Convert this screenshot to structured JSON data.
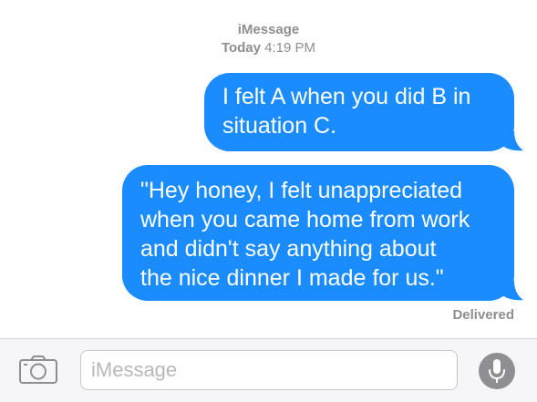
{
  "conversation_header": {
    "service": "iMessage",
    "day": "Today",
    "time": "4:19 PM"
  },
  "messages": [
    {
      "direction": "outgoing",
      "text": "I felt A when you did B in\nsituation C."
    },
    {
      "direction": "outgoing",
      "text": "\"Hey honey, I felt unappreciated\nwhen you came home from work\nand didn't say anything about\nthe nice dinner I made for us.\""
    }
  ],
  "delivery_status": "Delivered",
  "input_bar": {
    "placeholder": "iMessage",
    "value": "",
    "left_icon": "camera-icon",
    "right_icon": "microphone-icon"
  },
  "colors": {
    "bubble": "#1a8cff",
    "meta_text": "#8e8e93",
    "bar_background": "#f6f6f8"
  }
}
